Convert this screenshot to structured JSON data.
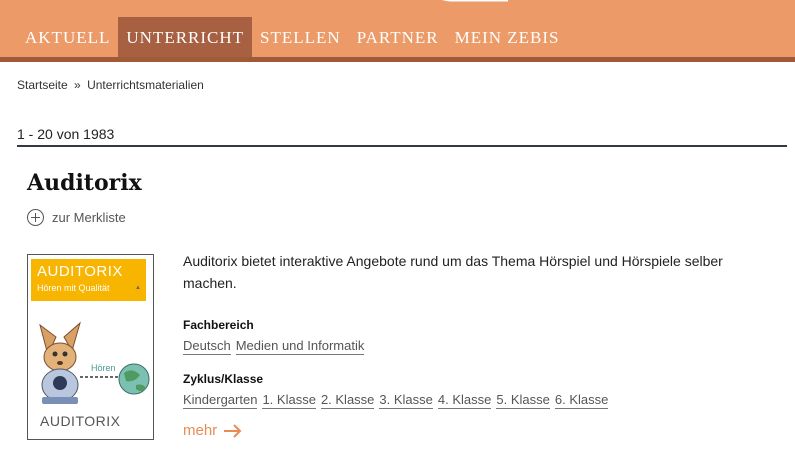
{
  "nav": {
    "items": [
      {
        "label": "AKTUELL",
        "active": false
      },
      {
        "label": "UNTERRICHT",
        "active": true
      },
      {
        "label": "STELLEN",
        "active": false
      },
      {
        "label": "PARTNER",
        "active": false
      },
      {
        "label": "MEIN ZEBIS",
        "active": false
      }
    ]
  },
  "breadcrumb": {
    "home": "Startseite",
    "separator": "»",
    "current": "Unterrichtsmaterialien"
  },
  "results": {
    "count": "1 - 20 von 1983"
  },
  "item": {
    "title": "Auditorix",
    "bookmark_label": "zur Merkliste",
    "thumbnail": {
      "banner_title": "AUDITORIX",
      "banner_subtitle": "Hören mit Qualität",
      "bubble_text": "Hören",
      "caption": "AUDITORIX"
    },
    "description": "Auditorix bietet interaktive Angebote rund um das Thema Hörspiel und Hörspiele selber machen.",
    "fachbereich_label": "Fachbereich",
    "fachbereich": [
      "Deutsch",
      "Medien und Informatik"
    ],
    "zyklus_label": "Zyklus/Klasse",
    "zyklus": [
      "Kindergarten",
      "1. Klasse",
      "2. Klasse",
      "3. Klasse",
      "4. Klasse",
      "5. Klasse",
      "6. Klasse"
    ],
    "more_label": "mehr"
  },
  "colors": {
    "nav_bg": "#eb9a68",
    "nav_active": "#a86042",
    "accent": "#e88c54",
    "banner": "#f7b500"
  }
}
